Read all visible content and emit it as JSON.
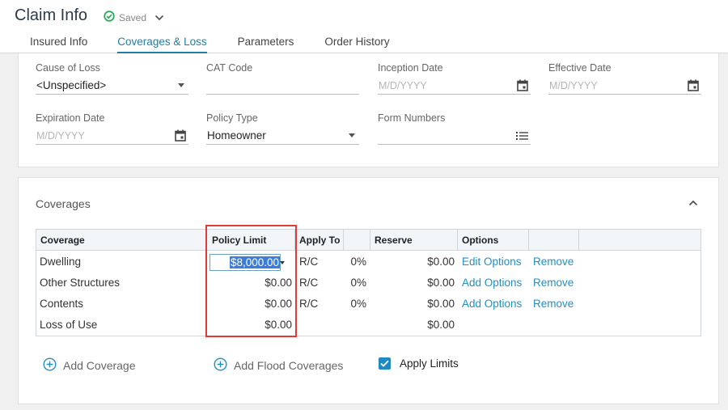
{
  "header": {
    "title": "Claim Info",
    "saved_label": "Saved",
    "tabs": [
      {
        "label": "Insured Info"
      },
      {
        "label": "Coverages & Loss"
      },
      {
        "label": "Parameters"
      },
      {
        "label": "Order History"
      }
    ],
    "active_tab": "Coverages & Loss"
  },
  "policy": {
    "cause_of_loss": {
      "label": "Cause of Loss",
      "value": "<Unspecified>"
    },
    "cat_code": {
      "label": "CAT Code",
      "value": ""
    },
    "inception_date": {
      "label": "Inception Date",
      "placeholder": "M/D/YYYY"
    },
    "effective_date": {
      "label": "Effective Date",
      "placeholder": "M/D/YYYY"
    },
    "expiration_date": {
      "label": "Expiration Date",
      "placeholder": "M/D/YYYY"
    },
    "policy_type": {
      "label": "Policy Type",
      "value": "Homeowner"
    },
    "form_numbers": {
      "label": "Form Numbers",
      "value": ""
    }
  },
  "coverages": {
    "title": "Coverages",
    "columns": [
      "Coverage",
      "Policy Limit",
      "Apply To",
      "",
      "Reserve",
      "Options",
      ""
    ],
    "rows": [
      {
        "coverage": "Dwelling",
        "policy_limit": "$8,000.00",
        "apply_to": "R/C",
        "pct": "0%",
        "reserve": "$0.00",
        "option": "Edit Options",
        "remove": "Remove"
      },
      {
        "coverage": "Other Structures",
        "policy_limit": "$0.00",
        "apply_to": "R/C",
        "pct": "0%",
        "reserve": "$0.00",
        "option": "Add Options",
        "remove": "Remove"
      },
      {
        "coverage": "Contents",
        "policy_limit": "$0.00",
        "apply_to": "R/C",
        "pct": "0%",
        "reserve": "$0.00",
        "option": "Add Options",
        "remove": "Remove"
      },
      {
        "coverage": "Loss of Use",
        "policy_limit": "$0.00",
        "apply_to": "",
        "pct": "",
        "reserve": "$0.00",
        "option": "",
        "remove": ""
      }
    ],
    "add_coverage": "Add Coverage",
    "add_flood": "Add Flood Coverages",
    "apply_limits": {
      "label": "Apply Limits",
      "checked": true
    }
  },
  "colors": {
    "accent": "#1f7ea8",
    "link": "#1e90c8",
    "checkbox": "#1f8ac2",
    "highlight": "#e03a3a",
    "saved_check": "#2eaa5c"
  }
}
